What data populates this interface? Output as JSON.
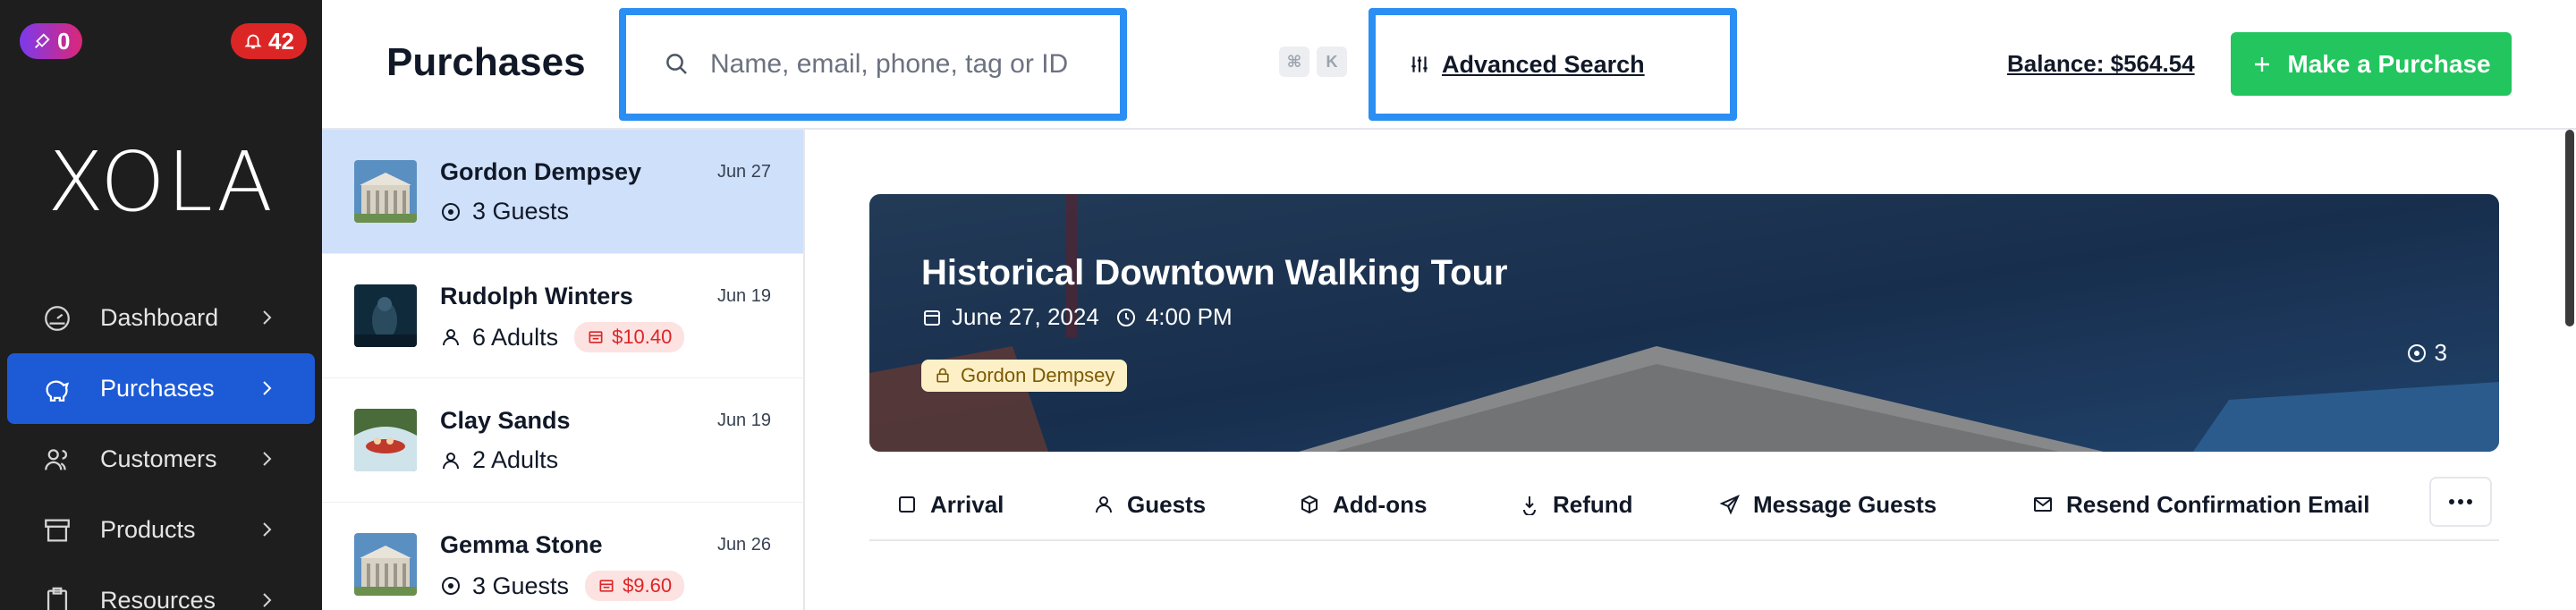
{
  "sidebar": {
    "notif_left": "0",
    "notif_right": "42",
    "logo": "XOLA",
    "items": [
      {
        "label": "Dashboard",
        "icon": "gauge-icon"
      },
      {
        "label": "Purchases",
        "icon": "piggy-bank-icon",
        "active": true
      },
      {
        "label": "Customers",
        "icon": "users-icon"
      },
      {
        "label": "Products",
        "icon": "box-icon"
      },
      {
        "label": "Resources",
        "icon": "clipboard-icon"
      }
    ]
  },
  "header": {
    "title": "Purchases",
    "search_placeholder": "Name, email, phone, tag or ID",
    "shortcut_cmd": "⌘",
    "shortcut_key": "K",
    "advanced_search": "Advanced Search",
    "balance": "Balance: $564.54",
    "make_purchase": "Make a Purchase"
  },
  "purchases": [
    {
      "name": "Gordon Dempsey",
      "date": "Jun 27",
      "guests": "3 Guests",
      "guest_icon": "target-icon",
      "badge": ""
    },
    {
      "name": "Rudolph Winters",
      "date": "Jun 19",
      "guests": "6 Adults",
      "guest_icon": "person-icon",
      "badge": "$10.40"
    },
    {
      "name": "Clay Sands",
      "date": "Jun 19",
      "guests": "2 Adults",
      "guest_icon": "person-icon",
      "badge": ""
    },
    {
      "name": "Gemma Stone",
      "date": "Jun 26",
      "guests": "3 Guests",
      "guest_icon": "target-icon",
      "badge": "$9.60"
    }
  ],
  "detail": {
    "title": "Historical Downtown Walking Tour",
    "date": "June 27, 2024",
    "time": "4:00 PM",
    "customer": "Gordon Dempsey",
    "guest_count": "3",
    "actions": [
      "Arrival",
      "Guests",
      "Add-ons",
      "Refund",
      "Message Guests",
      "Resend Confirmation Email"
    ]
  },
  "colors": {
    "accent": "#1d5bd6",
    "highlight": "#2b8ef2",
    "success": "#22c55e",
    "danger": "#dc2626"
  }
}
